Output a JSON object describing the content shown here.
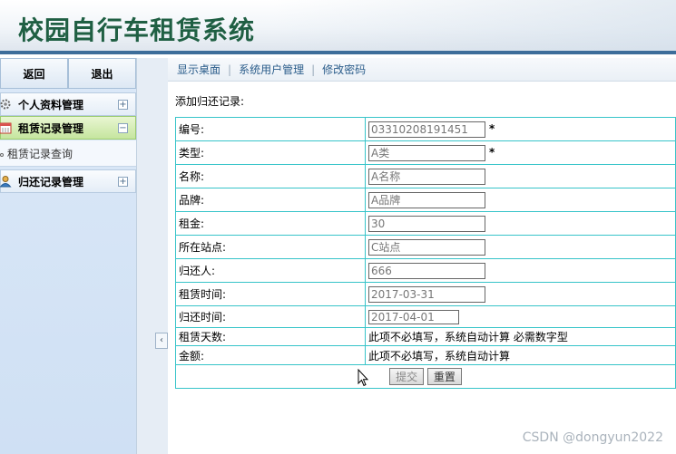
{
  "header": {
    "title": "校园自行车租赁系统"
  },
  "sidebar": {
    "buttons": {
      "back": "返回",
      "logout": "退出"
    },
    "sections": [
      {
        "label": "个人资料管理",
        "icon": "gear-icon",
        "toggle": "+"
      },
      {
        "label": "租赁记录管理",
        "icon": "calendar-icon",
        "toggle": "−"
      },
      {
        "label": "归还记录管理",
        "icon": "user-icon",
        "toggle": "+"
      }
    ],
    "submenu": {
      "item": "租赁记录查询"
    }
  },
  "divider": {
    "handle": "‹"
  },
  "nav": {
    "links": [
      "显示桌面",
      "系统用户管理",
      "修改密码"
    ],
    "separator": "|"
  },
  "form": {
    "heading": "添加归还记录:",
    "required_mark": "*",
    "rows": [
      {
        "label": "编号:",
        "value": "03310208191451"
      },
      {
        "label": "类型:",
        "value": "A类"
      },
      {
        "label": "名称:",
        "value": "A名称"
      },
      {
        "label": "品牌:",
        "value": "A品牌"
      },
      {
        "label": "租金:",
        "value": "30"
      },
      {
        "label": "所在站点:",
        "value": "C站点"
      },
      {
        "label": "归还人:",
        "value": "666"
      },
      {
        "label": "租赁时间:",
        "value": "2017-03-31"
      },
      {
        "label": "归还时间:",
        "value": "2017-04-01"
      }
    ],
    "notes": [
      {
        "label": "租赁天数:",
        "text": "此项不必填写，系统自动计算 必需数字型"
      },
      {
        "label": "金额:",
        "text": "此项不必填写，系统自动计算"
      }
    ],
    "submit": "提交",
    "reset": "重置"
  },
  "watermark": "CSDN @dongyun2022"
}
